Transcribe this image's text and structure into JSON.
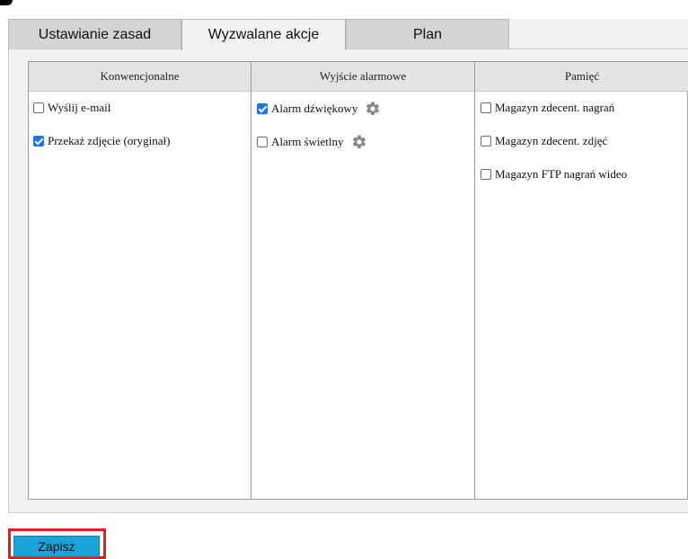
{
  "tabs": [
    {
      "label": "Ustawianie zasad"
    },
    {
      "label": "Wyzwalane akcje"
    },
    {
      "label": "Plan"
    }
  ],
  "active_tab": "Wyzwalane akcje",
  "columns": {
    "conventional": {
      "header": "Konwencjonalne",
      "items": [
        {
          "label": "Wyślij e-mail",
          "checked": false
        },
        {
          "label": "Przekaż zdjęcie (oryginał)",
          "checked": true
        }
      ]
    },
    "alarm_output": {
      "header": "Wyjście alarmowe",
      "items": [
        {
          "label": "Alarm dźwiękowy",
          "checked": true,
          "icon": "gear-icon"
        },
        {
          "label": "Alarm świetlny",
          "checked": false,
          "icon": "gear-icon"
        }
      ]
    },
    "storage": {
      "header": "Pamięć",
      "items": [
        {
          "label": "Magazyn zdecent. nagrań",
          "checked": false
        },
        {
          "label": "Magazyn zdecent. zdjęć",
          "checked": false
        },
        {
          "label": "Magazyn FTP nagrań wideo",
          "checked": false
        }
      ]
    }
  },
  "save_button": {
    "label": "Zapisz"
  },
  "colors": {
    "accent_blue": "#1aa3d9",
    "checkbox_blue": "#1a73e8",
    "highlight_red": "#e02020"
  }
}
